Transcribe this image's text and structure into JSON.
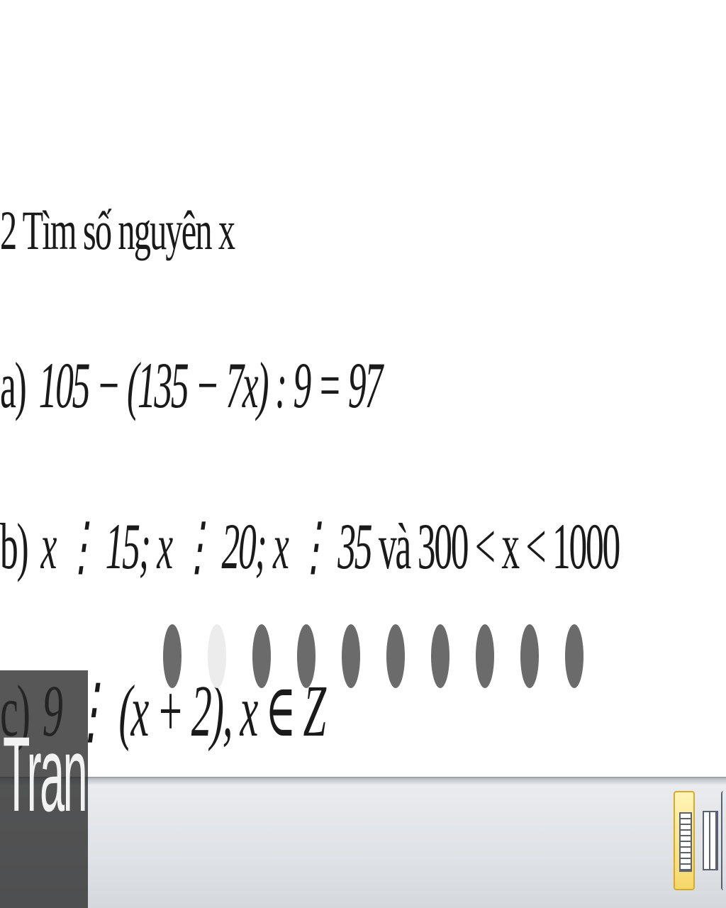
{
  "exercise": {
    "title": "2 Tìm số nguyên x",
    "items": [
      {
        "label": "a)",
        "expression": "105 − (135 − 7x) : 9 = 97"
      },
      {
        "label": "b)",
        "expression": "x ⋮ 15; x ⋮ 20; x ⋮ 35",
        "tail": "và 300 < x < 1000"
      },
      {
        "label": "c)",
        "expression": "9 ⋮ (x + 2), x ∈ Z"
      }
    ]
  },
  "slide_indicator": {
    "count": 10,
    "active_index": 1
  },
  "status_bar": {
    "view_buttons": [
      {
        "icon": "print-layout-icon",
        "active": true
      },
      {
        "icon": "full-screen-reading-icon",
        "active": false
      },
      {
        "icon": "web-layout-icon",
        "active": false
      }
    ]
  },
  "watermark": {
    "text": "Tran"
  }
}
